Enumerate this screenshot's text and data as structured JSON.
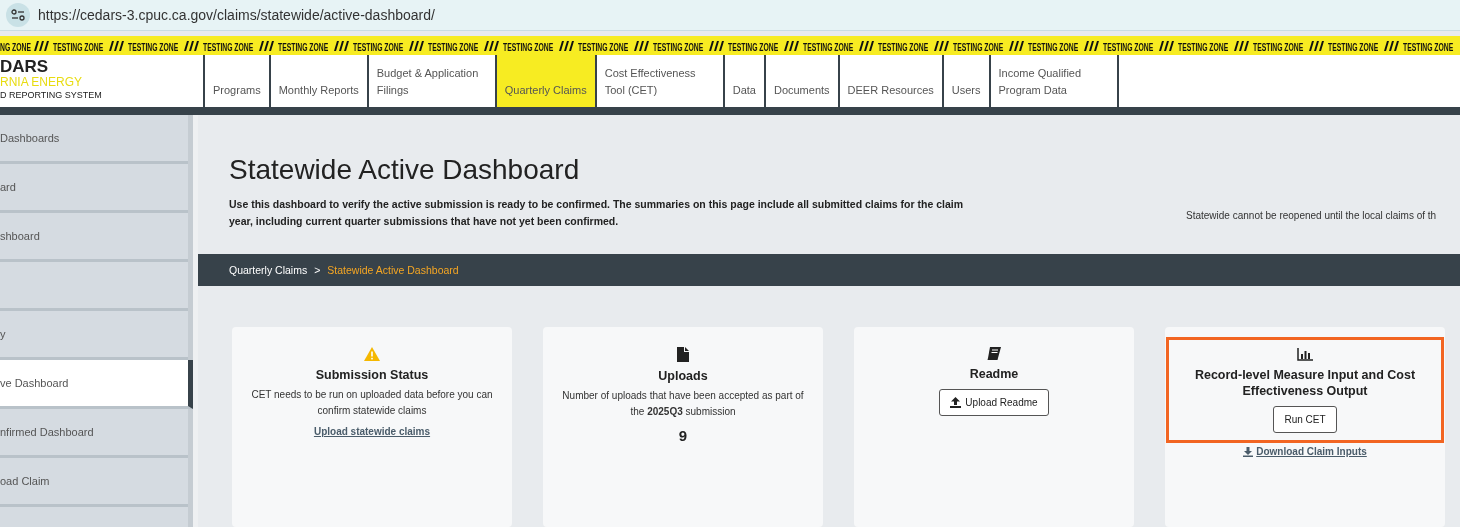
{
  "browser": {
    "url": "https://cedars-3.cpuc.ca.gov/claims/statewide/active-dashboard/"
  },
  "testing_banner": [
    "NG ZONE",
    "TESTING ZONE",
    "TESTING ZONE",
    "TESTING ZONE",
    "TESTING ZONE",
    "TESTING ZONE",
    "TESTING ZONE",
    "TESTING ZONE",
    "TESTING ZONE",
    "TESTING ZONE",
    "TESTING ZONE",
    "TESTING ZONE",
    "TESTING ZONE",
    "TESTING ZONE",
    "TESTING ZONE",
    "TESTING ZONE",
    "TESTING ZONE",
    "TESTING ZONE",
    "TESTING ZONE",
    "TESTING ZONE"
  ],
  "logo": {
    "name": "DARS",
    "line_1": "RNIA ENERGY",
    "line_2": "D REPORTING SYSTEM"
  },
  "nav": [
    {
      "label": "Programs",
      "selected": false
    },
    {
      "label": "Monthly Reports",
      "selected": false
    },
    {
      "label": "Budget & Application Filings",
      "selected": false
    },
    {
      "label": "Quarterly Claims",
      "selected": true
    },
    {
      "label": "Cost Effectiveness Tool (CET)",
      "selected": false
    },
    {
      "label": "Data",
      "selected": false
    },
    {
      "label": "Documents",
      "selected": false
    },
    {
      "label": "DEER Resources",
      "selected": false
    },
    {
      "label": "Users",
      "selected": false
    },
    {
      "label": "Income Qualified Program Data",
      "selected": false
    }
  ],
  "sidebar": {
    "items": [
      {
        "label": "Dashboards",
        "selected": false
      },
      {
        "label": "ard",
        "selected": false
      },
      {
        "label": "shboard",
        "selected": false
      },
      {
        "selected": false
      },
      {
        "label": "y",
        "selected": false
      },
      {
        "label": "ve Dashboard",
        "selected": true
      },
      {
        "label": "nfirmed Dashboard",
        "selected": false
      },
      {
        "label": "oad Claim",
        "selected": false
      }
    ]
  },
  "page": {
    "title": "Statewide Active Dashboard",
    "description": "Use this dashboard to verify the active submission is ready to be confirmed. The summaries on this page include all submitted claims for the claim year, including current quarter submissions that have not yet been confirmed.",
    "notice": "Statewide cannot be reopened until the local claims of th"
  },
  "breadcrumb": [
    {
      "label": "Quarterly Claims",
      "current": false
    },
    {
      "label": "Statewide Active Dashboard",
      "current": true
    }
  ],
  "breadcrumb_separator": ">",
  "cards": [
    {
      "kind": "status",
      "title": "Submission Status",
      "text": "CET needs to be run on uploaded data before you can confirm statewide claims",
      "link": "Upload statewide claims"
    },
    {
      "kind": "uploads",
      "title": "Uploads",
      "text": "Number of uploads that have been accepted as part of the **2025Q3** submission",
      "count": "9"
    },
    {
      "kind": "readme",
      "title": "Readme",
      "button": "Upload Readme"
    },
    {
      "kind": "cet",
      "title": "Record-level Measure Input and Cost Effectiveness Output",
      "button": "Run CET",
      "link": "Download Claim Inputs",
      "highlighted": true
    }
  ]
}
